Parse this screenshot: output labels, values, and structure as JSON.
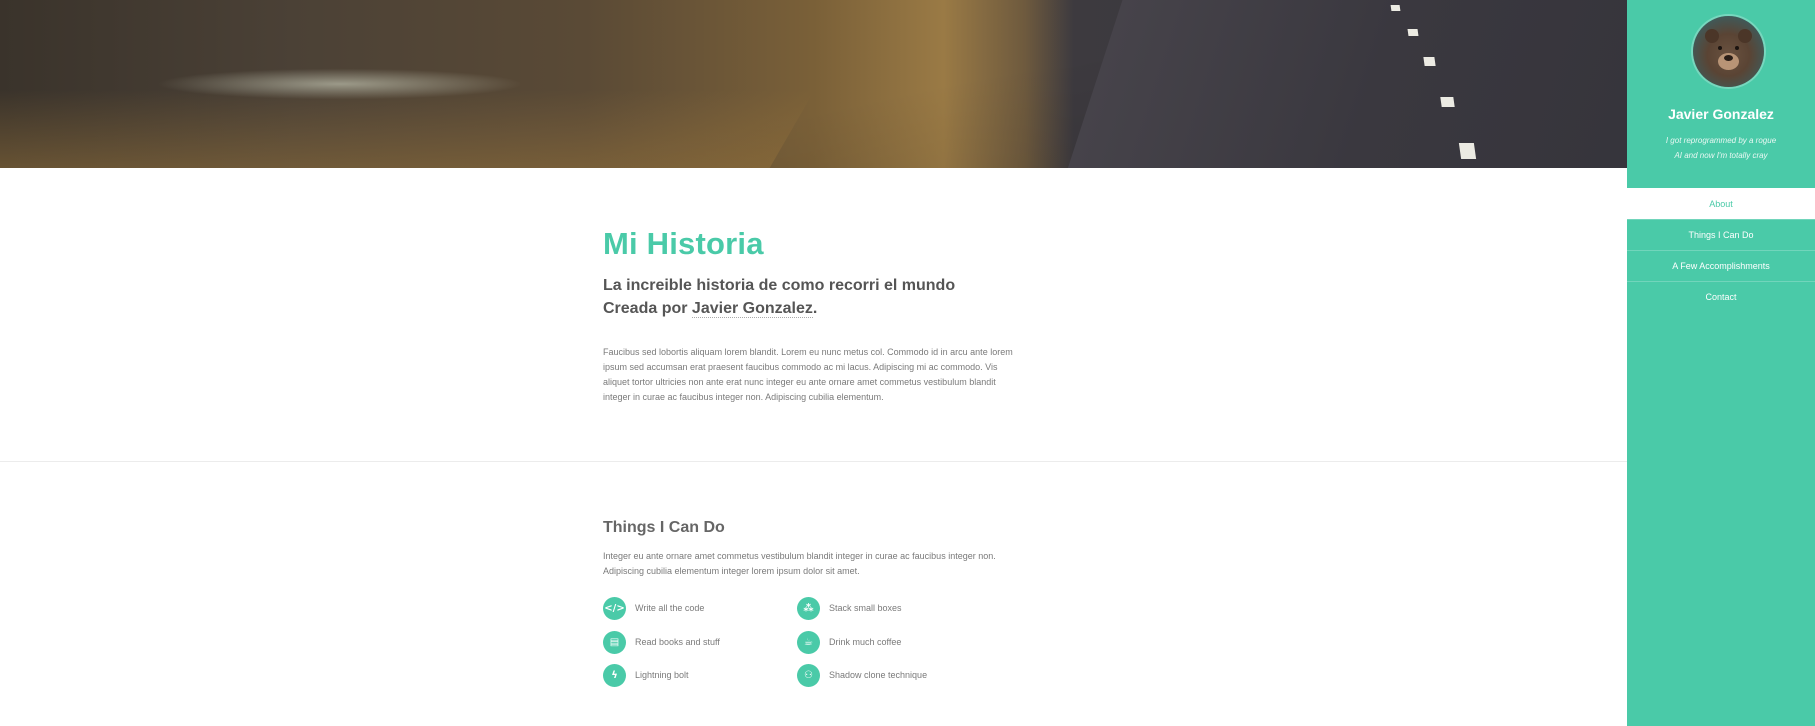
{
  "hero": {},
  "main": {
    "title": "Mi Historia",
    "subtitle_line1": "La increible historia de como recorri el mundo",
    "subtitle_prefix": "Creada por ",
    "subtitle_author": "Javier Gonzalez",
    "subtitle_suffix": ".",
    "paragraph": "Faucibus sed lobortis aliquam lorem blandit. Lorem eu nunc metus col. Commodo id in arcu ante lorem ipsum sed accumsan erat praesent faucibus commodo ac mi lacus. Adipiscing mi ac commodo. Vis aliquet tortor ultricies non ante erat nunc integer eu ante ornare amet commetus vestibulum blandit integer in curae ac faucibus integer non. Adipiscing cubilia elementum."
  },
  "skills_section": {
    "title": "Things I Can Do",
    "text": "Integer eu ante ornare amet commetus vestibulum blandit integer in curae ac faucibus integer non. Adipiscing cubilia elementum integer lorem ipsum dolor sit amet.",
    "items": [
      {
        "label": "Write all the code",
        "icon": "code-icon",
        "glyph": "</>"
      },
      {
        "label": "Stack small boxes",
        "icon": "cubes-icon",
        "glyph": "⁂"
      },
      {
        "label": "Read books and stuff",
        "icon": "book-icon",
        "glyph": "▤"
      },
      {
        "label": "Drink much coffee",
        "icon": "coffee-icon",
        "glyph": "☕"
      },
      {
        "label": "Lightning bolt",
        "icon": "bolt-icon",
        "glyph": "ϟ"
      },
      {
        "label": "Shadow clone technique",
        "icon": "users-icon",
        "glyph": "⚇"
      }
    ]
  },
  "sidebar": {
    "name": "Javier Gonzalez",
    "bio": "I got reprogrammed by a rogue AI and now I'm totally cray",
    "nav": [
      {
        "label": "About",
        "active": true
      },
      {
        "label": "Things I Can Do",
        "active": false
      },
      {
        "label": "A Few Accomplishments",
        "active": false
      },
      {
        "label": "Contact",
        "active": false
      }
    ]
  },
  "colors": {
    "accent": "#4acaa8",
    "text": "#777777",
    "heading": "#555555"
  }
}
